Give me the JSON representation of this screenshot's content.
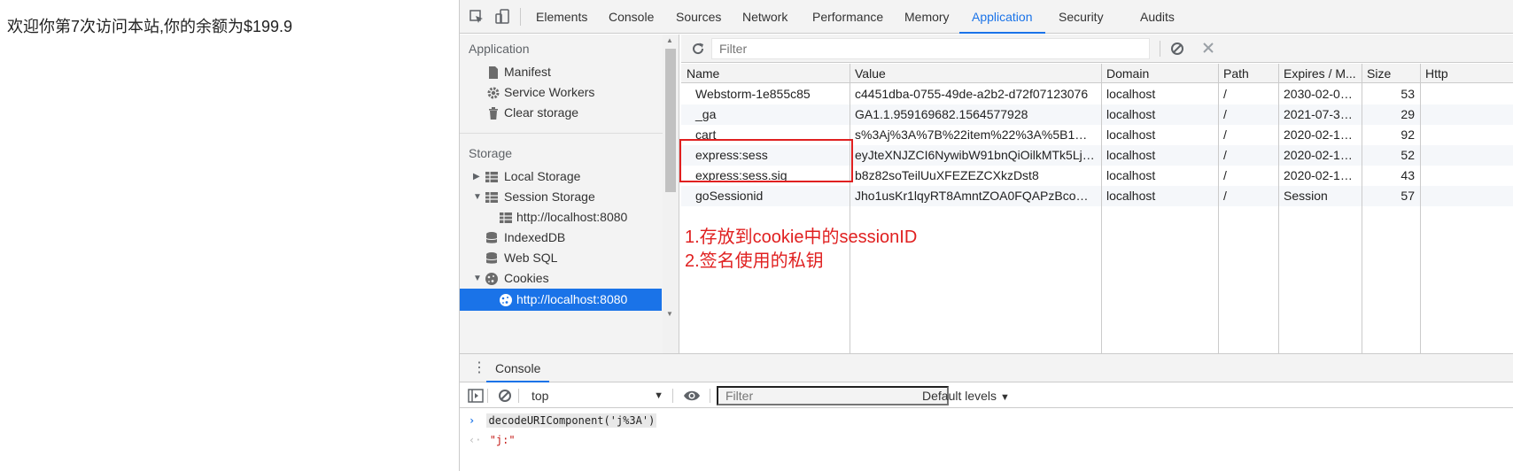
{
  "page": {
    "message": "欢迎你第7次访问本站,你的余额为$199.9"
  },
  "devtools": {
    "tabs": [
      "Elements",
      "Console",
      "Sources",
      "Network",
      "Performance",
      "Memory",
      "Application",
      "Security",
      "Audits"
    ],
    "active_tab": "Application",
    "sidebar": {
      "application_header": "Application",
      "manifest": "Manifest",
      "service_workers": "Service Workers",
      "clear_storage": "Clear storage",
      "storage_header": "Storage",
      "local_storage": "Local Storage",
      "session_storage": "Session Storage",
      "session_storage_origin": "http://localhost:8080",
      "indexeddb": "IndexedDB",
      "web_sql": "Web SQL",
      "cookies": "Cookies",
      "cookies_origin": "http://localhost:8080"
    },
    "cookies": {
      "filter_placeholder": "Filter",
      "columns": [
        "Name",
        "Value",
        "Domain",
        "Path",
        "Expires / M...",
        "Size",
        "Http"
      ],
      "rows": [
        {
          "name": "Webstorm-1e855c85",
          "value": "c4451dba-0755-49de-a2b2-d72f07123076",
          "domain": "localhost",
          "path": "/",
          "expires": "2030-02-07...",
          "size": "53"
        },
        {
          "name": "_ga",
          "value": "GA1.1.959169682.1564577928",
          "domain": "localhost",
          "path": "/",
          "expires": "2021-07-30...",
          "size": "29"
        },
        {
          "name": "cart",
          "value": "s%3Aj%3A%7B%22item%22%3A%5B1%2C...",
          "domain": "localhost",
          "path": "/",
          "expires": "2020-02-14...",
          "size": "92"
        },
        {
          "name": "express:sess",
          "value": "eyJteXNJZCI6NywibW91bnQiOilkMTk5Ljkif...",
          "domain": "localhost",
          "path": "/",
          "expires": "2020-02-13...",
          "size": "52"
        },
        {
          "name": "express:sess.sig",
          "value": "b8z82soTeilUuXFEZEZCXkzDst8",
          "domain": "localhost",
          "path": "/",
          "expires": "2020-02-13...",
          "size": "43"
        },
        {
          "name": "goSessionid",
          "value": "Jho1usKr1lqyRT8AmntZOA0FQAPzBcoWbT...",
          "domain": "localhost",
          "path": "/",
          "expires": "Session",
          "size": "57"
        }
      ],
      "annotation_line1": "1.存放到cookie中的sessionID",
      "annotation_line2": "2.签名使用的私钥"
    },
    "console": {
      "tab_label": "Console",
      "context": "top",
      "filter_placeholder": "Filter",
      "levels_label": "Default levels",
      "input_prompt": "›",
      "input_code": "decodeURIComponent('j%3A')",
      "output_prompt": "‹·",
      "output_value": "\"j:\""
    },
    "colors": {
      "accent": "#1a73e8",
      "annotation": "#e02020"
    }
  }
}
